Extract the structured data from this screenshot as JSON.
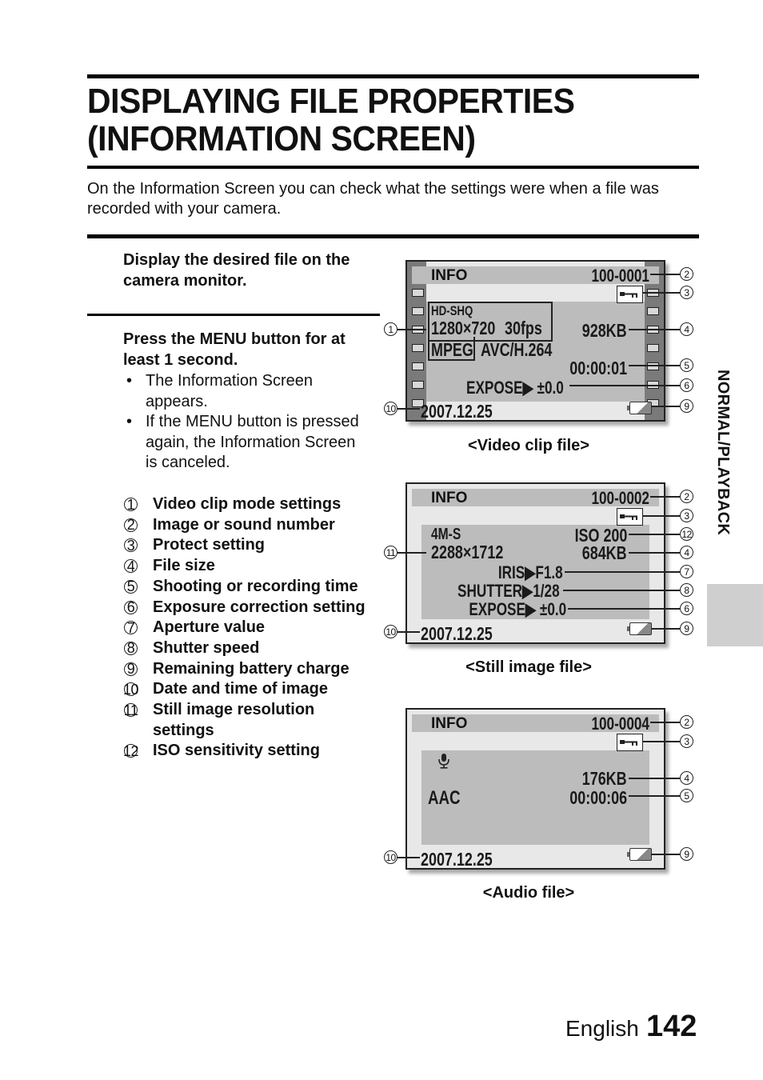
{
  "page": {
    "title_line1": "DISPLAYING FILE PROPERTIES",
    "title_line2": "(INFORMATION SCREEN)",
    "intro": "On the Information Screen you can check what the settings were when a file was recorded with your camera.",
    "side_tab_label": "NORMAL/PLAYBACK",
    "footer_language": "English",
    "footer_page_number": "142"
  },
  "steps": [
    {
      "text": "Display the desired file on the camera monitor."
    },
    {
      "text": "Press the MENU button for at least 1 second.",
      "bullets": [
        "The Information Screen appears.",
        "If the MENU button is pressed again, the Information Screen is canceled."
      ]
    }
  ],
  "bullet_glyph": "•",
  "legend": [
    {
      "num": "1",
      "label": "Video clip mode settings"
    },
    {
      "num": "2",
      "label": "Image or sound number"
    },
    {
      "num": "3",
      "label": "Protect setting"
    },
    {
      "num": "4",
      "label": "File size"
    },
    {
      "num": "5",
      "label": "Shooting or recording time"
    },
    {
      "num": "6",
      "label": "Exposure correction setting"
    },
    {
      "num": "7",
      "label": "Aperture value"
    },
    {
      "num": "8",
      "label": "Shutter speed"
    },
    {
      "num": "9",
      "label": "Remaining battery charge"
    },
    {
      "num": "10",
      "label": "Date and time of image"
    },
    {
      "num": "11",
      "label": "Still image resolution settings"
    },
    {
      "num": "12",
      "label": "ISO sensitivity setting"
    }
  ],
  "screens": {
    "video": {
      "caption": "<Video clip file>",
      "header": "INFO",
      "file_number": "100-0001",
      "mode": "HD-SHQ",
      "resolution": "1280×720",
      "fps": "30fps",
      "format": "MPEG",
      "codec": "AVC/H.264",
      "file_size": "928KB",
      "time": "00:00:01",
      "expose": "EXPOSE▶ ±0.0",
      "date": "2007.12.25",
      "protect_icon": "key-icon",
      "battery_icon": "battery-icon",
      "callouts": [
        "1",
        "2",
        "3",
        "4",
        "5",
        "6",
        "9",
        "10"
      ]
    },
    "still": {
      "caption": "<Still image file>",
      "header": "INFO",
      "file_number": "100-0002",
      "size_mode": "4M-S",
      "resolution": "2288×1712",
      "iso": "ISO 200",
      "file_size": "684KB",
      "iris": "IRIS▶F1.8",
      "shutter": "SHUTTER▶1/28",
      "expose": "EXPOSE▶ ±0.0",
      "date": "2007.12.25",
      "callouts": [
        "2",
        "3",
        "12",
        "4",
        "7",
        "8",
        "6",
        "9",
        "10",
        "11"
      ]
    },
    "audio": {
      "caption": "<Audio file>",
      "header": "INFO",
      "file_number": "100-0004",
      "mic_icon": "microphone-icon",
      "file_size": "176KB",
      "codec": "AAC",
      "time": "00:00:06",
      "date": "2007.12.25",
      "callouts": [
        "2",
        "3",
        "4",
        "5",
        "9",
        "10"
      ]
    }
  }
}
